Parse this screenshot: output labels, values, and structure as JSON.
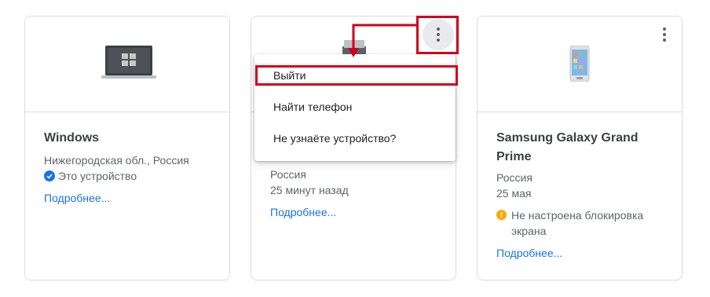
{
  "devices": [
    {
      "name": "Windows",
      "location": "Нижегородская обл., Россия",
      "status": "Это устройство",
      "details_link": "Подробнее..."
    },
    {
      "location": "Россия",
      "last_seen": "25 минут назад",
      "details_link": "Подробнее..."
    },
    {
      "name": "Samsung Galaxy Grand Prime",
      "location": "Россия",
      "last_seen": "25 мая",
      "warning": "Не настроена блокировка экрана",
      "details_link": "Подробнее..."
    }
  ],
  "context_menu": {
    "items": [
      "Выйти",
      "Найти телефон",
      "Не узнаёте устройство?"
    ]
  },
  "colors": {
    "link": "#1a73e8",
    "check": "#1a73e8",
    "warning": "#f9ab00",
    "highlight": "#d0021b",
    "border": "#dadce0"
  }
}
